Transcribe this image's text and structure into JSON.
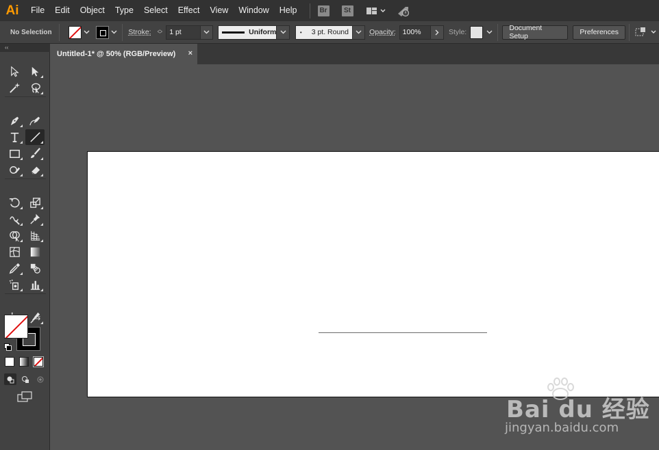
{
  "app": {
    "logo": "Ai"
  },
  "menu": [
    "File",
    "Edit",
    "Object",
    "Type",
    "Select",
    "Effect",
    "View",
    "Window",
    "Help"
  ],
  "menubar_apps": {
    "bridge": "Br",
    "stock": "St"
  },
  "control_bar": {
    "selection_status": "No Selection",
    "stroke_label": "Stroke:",
    "stroke_weight": "1 pt",
    "variable_width_profile": "Uniform",
    "brush_definition": "3 pt. Round",
    "opacity_label": "Opacity:",
    "opacity_value": "100%",
    "style_label": "Style:",
    "document_setup": "Document Setup",
    "preferences": "Preferences"
  },
  "tools_panel": {
    "collapse_glyph": "‹‹"
  },
  "document": {
    "tab_title": "Untitled-1* @ 50% (RGB/Preview)",
    "close_glyph": "×"
  },
  "watermark": {
    "logo_text": "Bai du 经验",
    "url": "jingyan.baidu.com"
  },
  "colors": {
    "accent_logo": "#ff9a00",
    "stroke_none_red": "#e01010",
    "canvas": "#535353",
    "artboard": "#ffffff"
  }
}
